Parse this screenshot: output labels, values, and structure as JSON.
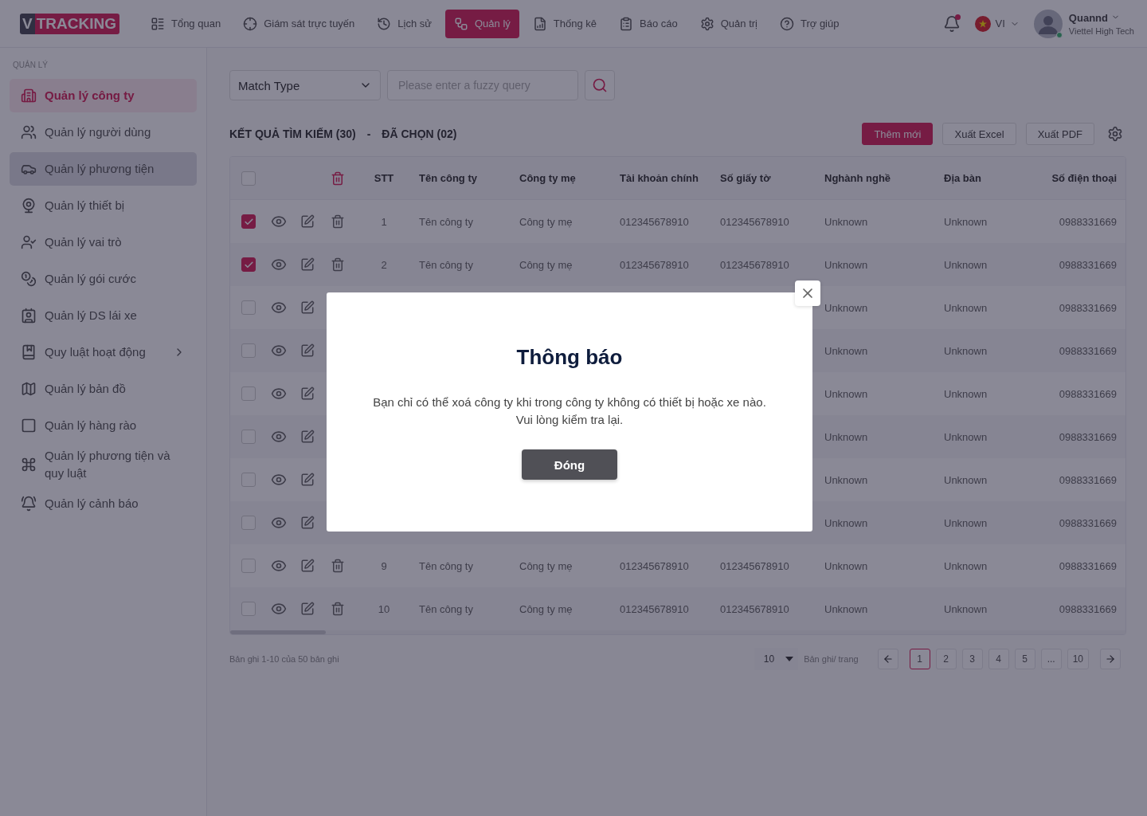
{
  "header": {
    "logo": {
      "mark": "V",
      "text": "TRACKING"
    },
    "nav": [
      {
        "label": "Tổng quan",
        "selected": false
      },
      {
        "label": "Giám sát trực tuyến",
        "selected": false
      },
      {
        "label": "Lịch sử",
        "selected": false
      },
      {
        "label": "Quản lý",
        "selected": true
      },
      {
        "label": "Thống kê",
        "selected": false
      },
      {
        "label": "Báo cáo",
        "selected": false
      },
      {
        "label": "Quản trị",
        "selected": false
      },
      {
        "label": "Trợ giúp",
        "selected": false
      }
    ],
    "notifications": {
      "unread": true
    },
    "language": {
      "code": "VI"
    },
    "user": {
      "name": "Quannd",
      "company": "Viettel High Tech",
      "online": true
    }
  },
  "sidebar": {
    "section": "QUẢN LÝ",
    "items": [
      {
        "label": "Quản lý công ty",
        "selected": true,
        "hovered": false,
        "expandable": false
      },
      {
        "label": "Quản lý người dùng",
        "selected": false,
        "hovered": false,
        "expandable": false
      },
      {
        "label": "Quản lý phương tiện",
        "selected": false,
        "hovered": true,
        "expandable": false
      },
      {
        "label": "Quản lý thiết bị",
        "selected": false,
        "hovered": false,
        "expandable": false
      },
      {
        "label": "Quản lý vai trò",
        "selected": false,
        "hovered": false,
        "expandable": false
      },
      {
        "label": "Quản lý gói cước",
        "selected": false,
        "hovered": false,
        "expandable": false
      },
      {
        "label": "Quản lý DS lái xe",
        "selected": false,
        "hovered": false,
        "expandable": false
      },
      {
        "label": "Quy luật hoạt động",
        "selected": false,
        "hovered": false,
        "expandable": true
      },
      {
        "label": "Quản lý bản đồ",
        "selected": false,
        "hovered": false,
        "expandable": false
      },
      {
        "label": "Quản lý hàng rào",
        "selected": false,
        "hovered": false,
        "expandable": false
      },
      {
        "label": "Quản lý phương tiện và quy luật",
        "selected": false,
        "hovered": false,
        "expandable": false
      },
      {
        "label": "Quản lý cảnh báo",
        "selected": false,
        "hovered": false,
        "expandable": false
      }
    ]
  },
  "filters": {
    "match_type": {
      "value": "Match Type"
    },
    "search": {
      "placeholder": "Please enter a fuzzy query"
    }
  },
  "results": {
    "found": "KẾT QUẢ TÌM KIẾM (30)",
    "separator": "-",
    "picked": "ĐÃ CHỌN (02)"
  },
  "actions": [
    {
      "label": "Thêm mới",
      "kind": "primary"
    },
    {
      "label": "Xuất Excel",
      "kind": "outline"
    },
    {
      "label": "Xuất PDF",
      "kind": "outline"
    }
  ],
  "table": {
    "all_checked": false,
    "columns": [
      "STT",
      "Tên công ty",
      "Công ty mẹ",
      "Tài khoản chính",
      "Số giấy tờ",
      "Nghành nghề",
      "Địa bàn",
      "Số điện thoại"
    ],
    "rows": [
      {
        "checked": true,
        "stt": "1",
        "name": "Tên công ty",
        "parent": "Công ty mẹ",
        "account": "012345678910",
        "doc_no": "012345678910",
        "industry": "Unknown",
        "area": "Unknown",
        "phone": "0988331669"
      },
      {
        "checked": true,
        "stt": "2",
        "name": "Tên công ty",
        "parent": "Công ty mẹ",
        "account": "012345678910",
        "doc_no": "012345678910",
        "industry": "Unknown",
        "area": "Unknown",
        "phone": "0988331669"
      },
      {
        "checked": false,
        "industry": "Unknown",
        "area": "Unknown",
        "phone": "0988331669"
      },
      {
        "checked": false,
        "industry": "Unknown",
        "area": "Unknown",
        "phone": "0988331669"
      },
      {
        "checked": false,
        "industry": "Unknown",
        "area": "Unknown",
        "phone": "0988331669"
      },
      {
        "checked": false,
        "industry": "Unknown",
        "area": "Unknown",
        "phone": "0988331669"
      },
      {
        "checked": false,
        "industry": "Unknown",
        "area": "Unknown",
        "phone": "0988331669"
      },
      {
        "checked": false,
        "industry": "Unknown",
        "area": "Unknown",
        "phone": "0988331669"
      },
      {
        "checked": false,
        "stt": "9",
        "name": "Tên công ty",
        "parent": "Công ty mẹ",
        "account": "012345678910",
        "doc_no": "012345678910",
        "industry": "Unknown",
        "area": "Unknown",
        "phone": "0988331669"
      },
      {
        "checked": false,
        "stt": "10",
        "name": "Tên công ty",
        "parent": "Công ty mẹ",
        "account": "012345678910",
        "doc_no": "012345678910",
        "industry": "Unknown",
        "area": "Unknown",
        "phone": "0988331669"
      }
    ]
  },
  "pagination": {
    "summary": "Bản ghi 1-10 của 50 bản ghi",
    "page_size": "10",
    "page_size_label": "Bản ghi/ trang",
    "pages": [
      {
        "label": "1",
        "selected": true
      },
      {
        "label": "2",
        "selected": false
      },
      {
        "label": "3",
        "selected": false
      },
      {
        "label": "4",
        "selected": false
      },
      {
        "label": "5",
        "selected": false
      },
      {
        "label": "...",
        "selected": false
      },
      {
        "label": "10",
        "selected": false
      }
    ]
  },
  "dialog": {
    "title": "Thông báo",
    "message": "Bạn chỉ có thể xoá công ty khi trong công ty không có thiết bị hoặc xe nào. Vui lòng kiểm tra lại.",
    "button": "Đóng"
  }
}
